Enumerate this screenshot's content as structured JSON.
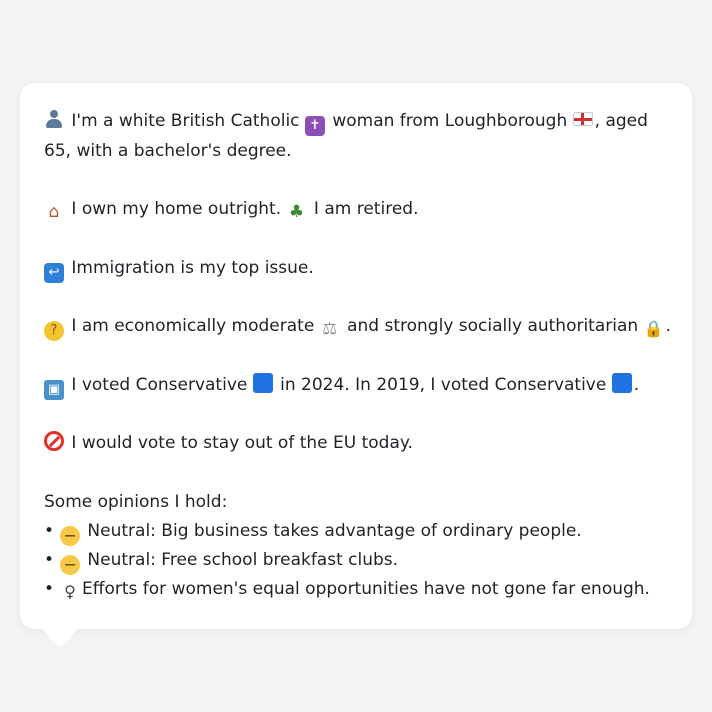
{
  "profile": {
    "identity_line": " I'm a white British Catholic ",
    "identity_line_2": " woman from Loughborough ",
    "identity_line_3": ", aged 65, with a bachelor's degree.",
    "home_text": " I own my home outright. ",
    "retired_text": " I am retired.",
    "issue_text": " Immigration is my top issue.",
    "ideology_text_1": " I am economically moderate ",
    "ideology_text_2": " and strongly socially authoritarian ",
    "ideology_text_3": ".",
    "vote_text_1": " I voted Conservative ",
    "vote_text_2": " in 2024. In 2019, I voted Conservative ",
    "vote_text_3": ".",
    "eu_text": " I would vote to stay out of the EU today."
  },
  "opinions": {
    "heading": "Some opinions I hold:",
    "items": [
      {
        "bullet": "•",
        "text": " Neutral: Big business takes advantage of ordinary people."
      },
      {
        "bullet": "•",
        "text": " Neutral: Free school breakfast clubs."
      },
      {
        "bullet": "•",
        "text": "Efforts for women's equal opportunities have not gone far enough."
      }
    ]
  },
  "icons": {
    "person": "person-icon",
    "cross": "latin-cross-icon",
    "flag": "england-flag-icon",
    "house": "house-icon",
    "palm": "palm-tree-icon",
    "arrows": "right-arrow-curving-left-icon",
    "thinking": "thinking-face-icon",
    "scale": "balance-scale-icon",
    "lock": "lock-icon",
    "ballot": "ballot-box-icon",
    "square": "blue-square-icon",
    "noentry": "prohibited-icon",
    "neutral": "neutral-face-icon",
    "female": "female-sign-icon"
  },
  "colors": {
    "background": "#f3f4f6",
    "card": "#ffffff",
    "text": "#1f2328",
    "conservative_blue": "#1e73e0",
    "prohibited_red": "#e0302a"
  }
}
